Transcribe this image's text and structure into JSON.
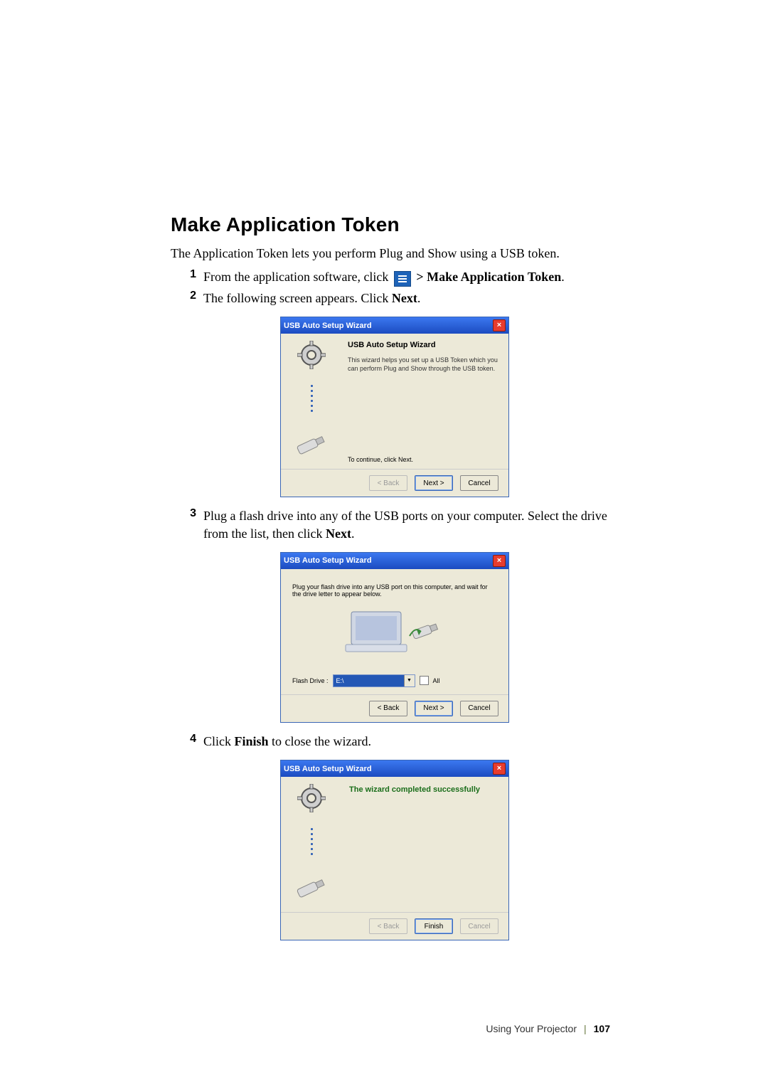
{
  "heading": "Make Application Token",
  "intro": "The Application Token lets you perform Plug and Show using a USB token.",
  "steps": {
    "s1_pre": "From the application software, click ",
    "s1_post": " > Make Application Token",
    "s1_dot": ".",
    "s2_pre": "The following screen appears. Click ",
    "s2_bold": "Next",
    "s2_dot": ".",
    "s3_pre": "Plug a flash drive into any of the USB ports on your computer. Select the drive from the list, then click ",
    "s3_bold": "Next",
    "s3_dot": ".",
    "s4_pre": "Click ",
    "s4_bold": "Finish",
    "s4_post": " to close the wizard."
  },
  "wizard": {
    "title": "USB Auto Setup Wizard",
    "intro_heading": "USB Auto Setup Wizard",
    "intro_text": "This wizard helps you set up a USB Token which you can perform Plug and Show through the USB token.",
    "continue_text": "To continue, click Next.",
    "step2_text": "Plug your flash drive into any USB port on this computer, and wait for the drive letter to appear below.",
    "flash_drive_label": "Flash Drive :",
    "flash_drive_value": "E:\\",
    "all_label": "All",
    "completed": "The wizard completed successfully",
    "buttons": {
      "back": "< Back",
      "next": "Next >",
      "cancel": "Cancel",
      "finish": "Finish"
    }
  },
  "footer": {
    "section": "Using Your Projector",
    "page": "107"
  }
}
